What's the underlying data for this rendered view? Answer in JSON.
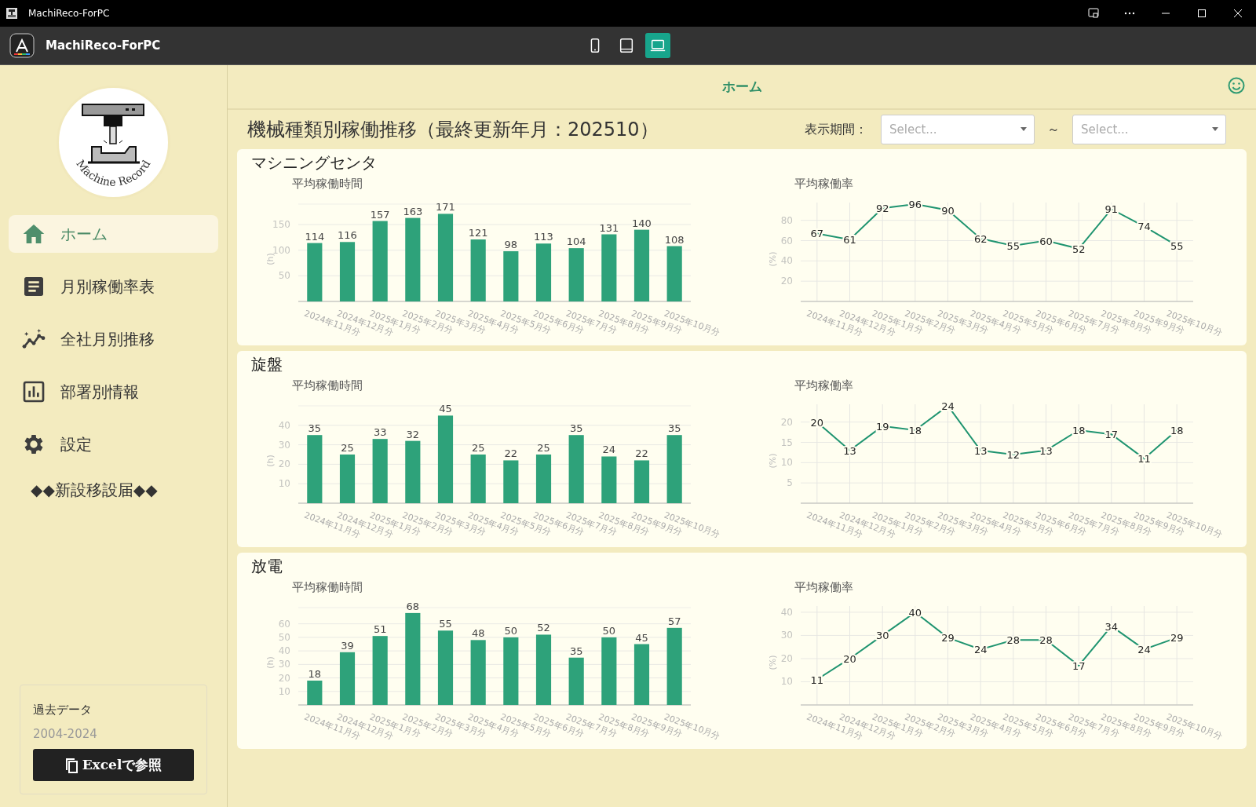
{
  "window": {
    "title": "MachiReco-ForPC"
  },
  "app_bar": {
    "title": "MachiReco-ForPC",
    "devices": [
      {
        "kind": "phone",
        "selected": false
      },
      {
        "kind": "tablet",
        "selected": false
      },
      {
        "kind": "laptop",
        "selected": true
      }
    ]
  },
  "sidebar": {
    "logo_text": "Machine Record",
    "items": [
      {
        "label": "ホーム",
        "selected": true
      },
      {
        "label": "月別稼働率表",
        "selected": false
      },
      {
        "label": "全社月別推移",
        "selected": false
      },
      {
        "label": "部署別情報",
        "selected": false
      },
      {
        "label": "設定",
        "selected": false
      }
    ],
    "notice": "◆◆新設移設届◆◆",
    "archive": {
      "title": "過去データ",
      "years": "2004-2024",
      "button": "Excelで参照"
    }
  },
  "header": {
    "title": "ホーム"
  },
  "page": {
    "title": "機械種類別稼働推移（最終更新年月：202510）",
    "period_label": "表示期間：",
    "period_from": {
      "placeholder": "Select..."
    },
    "separator": "～",
    "period_to": {
      "placeholder": "Select..."
    }
  },
  "sections": [
    {
      "title": "マシニングセンタ",
      "charts": [
        {
          "chart_data": {
            "type": "bar",
            "title": "平均稼働時間",
            "ylabel": "(h)",
            "categories": [
              "2024年11月分",
              "2024年12月分",
              "2025年1月分",
              "2025年2月分",
              "2025年3月分",
              "2025年4月分",
              "2025年5月分",
              "2025年6月分",
              "2025年7月分",
              "2025年8月分",
              "2025年9月分",
              "2025年10月分"
            ],
            "values": [
              114,
              116,
              157,
              163,
              171,
              121,
              98,
              113,
              104,
              131,
              140,
              108
            ],
            "ylim": [
              0,
              190
            ],
            "grid": true,
            "yticks": [
              50,
              100,
              150
            ],
            "data_labels": true
          }
        },
        {
          "chart_data": {
            "type": "line",
            "title": "平均稼働率",
            "ylabel": "(%)",
            "categories": [
              "2024年11月分",
              "2024年12月分",
              "2025年1月分",
              "2025年2月分",
              "2025年3月分",
              "2025年4月分",
              "2025年5月分",
              "2025年6月分",
              "2025年7月分",
              "2025年8月分",
              "2025年9月分",
              "2025年10月分"
            ],
            "values": [
              67,
              61,
              92,
              96,
              90,
              62,
              55,
              60,
              52,
              91,
              74,
              55
            ],
            "ylim": [
              0,
              96
            ],
            "grid": true,
            "yticks": [
              20,
              40,
              60,
              80
            ],
            "data_labels": true
          }
        }
      ]
    },
    {
      "title": "旋盤",
      "charts": [
        {
          "chart_data": {
            "type": "bar",
            "title": "平均稼働時間",
            "ylabel": "(h)",
            "categories": [
              "2024年11月分",
              "2024年12月分",
              "2025年1月分",
              "2025年2月分",
              "2025年3月分",
              "2025年4月分",
              "2025年5月分",
              "2025年6月分",
              "2025年7月分",
              "2025年8月分",
              "2025年9月分",
              "2025年10月分"
            ],
            "values": [
              35,
              25,
              33,
              32,
              45,
              25,
              22,
              25,
              35,
              24,
              22,
              35
            ],
            "ylim": [
              0,
              50
            ],
            "grid": true,
            "yticks": [
              10,
              20,
              30,
              40
            ],
            "data_labels": true
          }
        },
        {
          "chart_data": {
            "type": "line",
            "title": "平均稼働率",
            "ylabel": "(%)",
            "categories": [
              "2024年11月分",
              "2024年12月分",
              "2025年1月分",
              "2025年2月分",
              "2025年3月分",
              "2025年4月分",
              "2025年5月分",
              "2025年6月分",
              "2025年7月分",
              "2025年8月分",
              "2025年9月分",
              "2025年10月分"
            ],
            "values": [
              20,
              13,
              19,
              18,
              24,
              13,
              12,
              13,
              18,
              17,
              11,
              18
            ],
            "ylim": [
              0,
              24
            ],
            "grid": true,
            "yticks": [
              5,
              10,
              15,
              20
            ],
            "data_labels": true
          }
        }
      ]
    },
    {
      "title": "放電",
      "charts": [
        {
          "chart_data": {
            "type": "bar",
            "title": "平均稼働時間",
            "ylabel": "(h)",
            "categories": [
              "2024年11月分",
              "2024年12月分",
              "2025年1月分",
              "2025年2月分",
              "2025年3月分",
              "2025年4月分",
              "2025年5月分",
              "2025年6月分",
              "2025年7月分",
              "2025年8月分",
              "2025年9月分",
              "2025年10月分"
            ],
            "values": [
              18,
              39,
              51,
              68,
              55,
              48,
              50,
              52,
              35,
              50,
              45,
              57
            ],
            "ylim": [
              0,
              72
            ],
            "grid": true,
            "yticks": [
              10,
              20,
              30,
              40,
              50,
              60
            ],
            "data_labels": true
          }
        },
        {
          "chart_data": {
            "type": "line",
            "title": "平均稼働率",
            "ylabel": "(%)",
            "categories": [
              "2024年11月分",
              "2024年12月分",
              "2025年1月分",
              "2025年2月分",
              "2025年3月分",
              "2025年4月分",
              "2025年5月分",
              "2025年6月分",
              "2025年7月分",
              "2025年8月分",
              "2025年9月分",
              "2025年10月分"
            ],
            "values": [
              11,
              20,
              30,
              40,
              29,
              24,
              28,
              28,
              17,
              34,
              24,
              29
            ],
            "ylim": [
              0,
              42
            ],
            "grid": true,
            "yticks": [
              10,
              20,
              30,
              40
            ],
            "data_labels": true
          }
        }
      ]
    }
  ]
}
